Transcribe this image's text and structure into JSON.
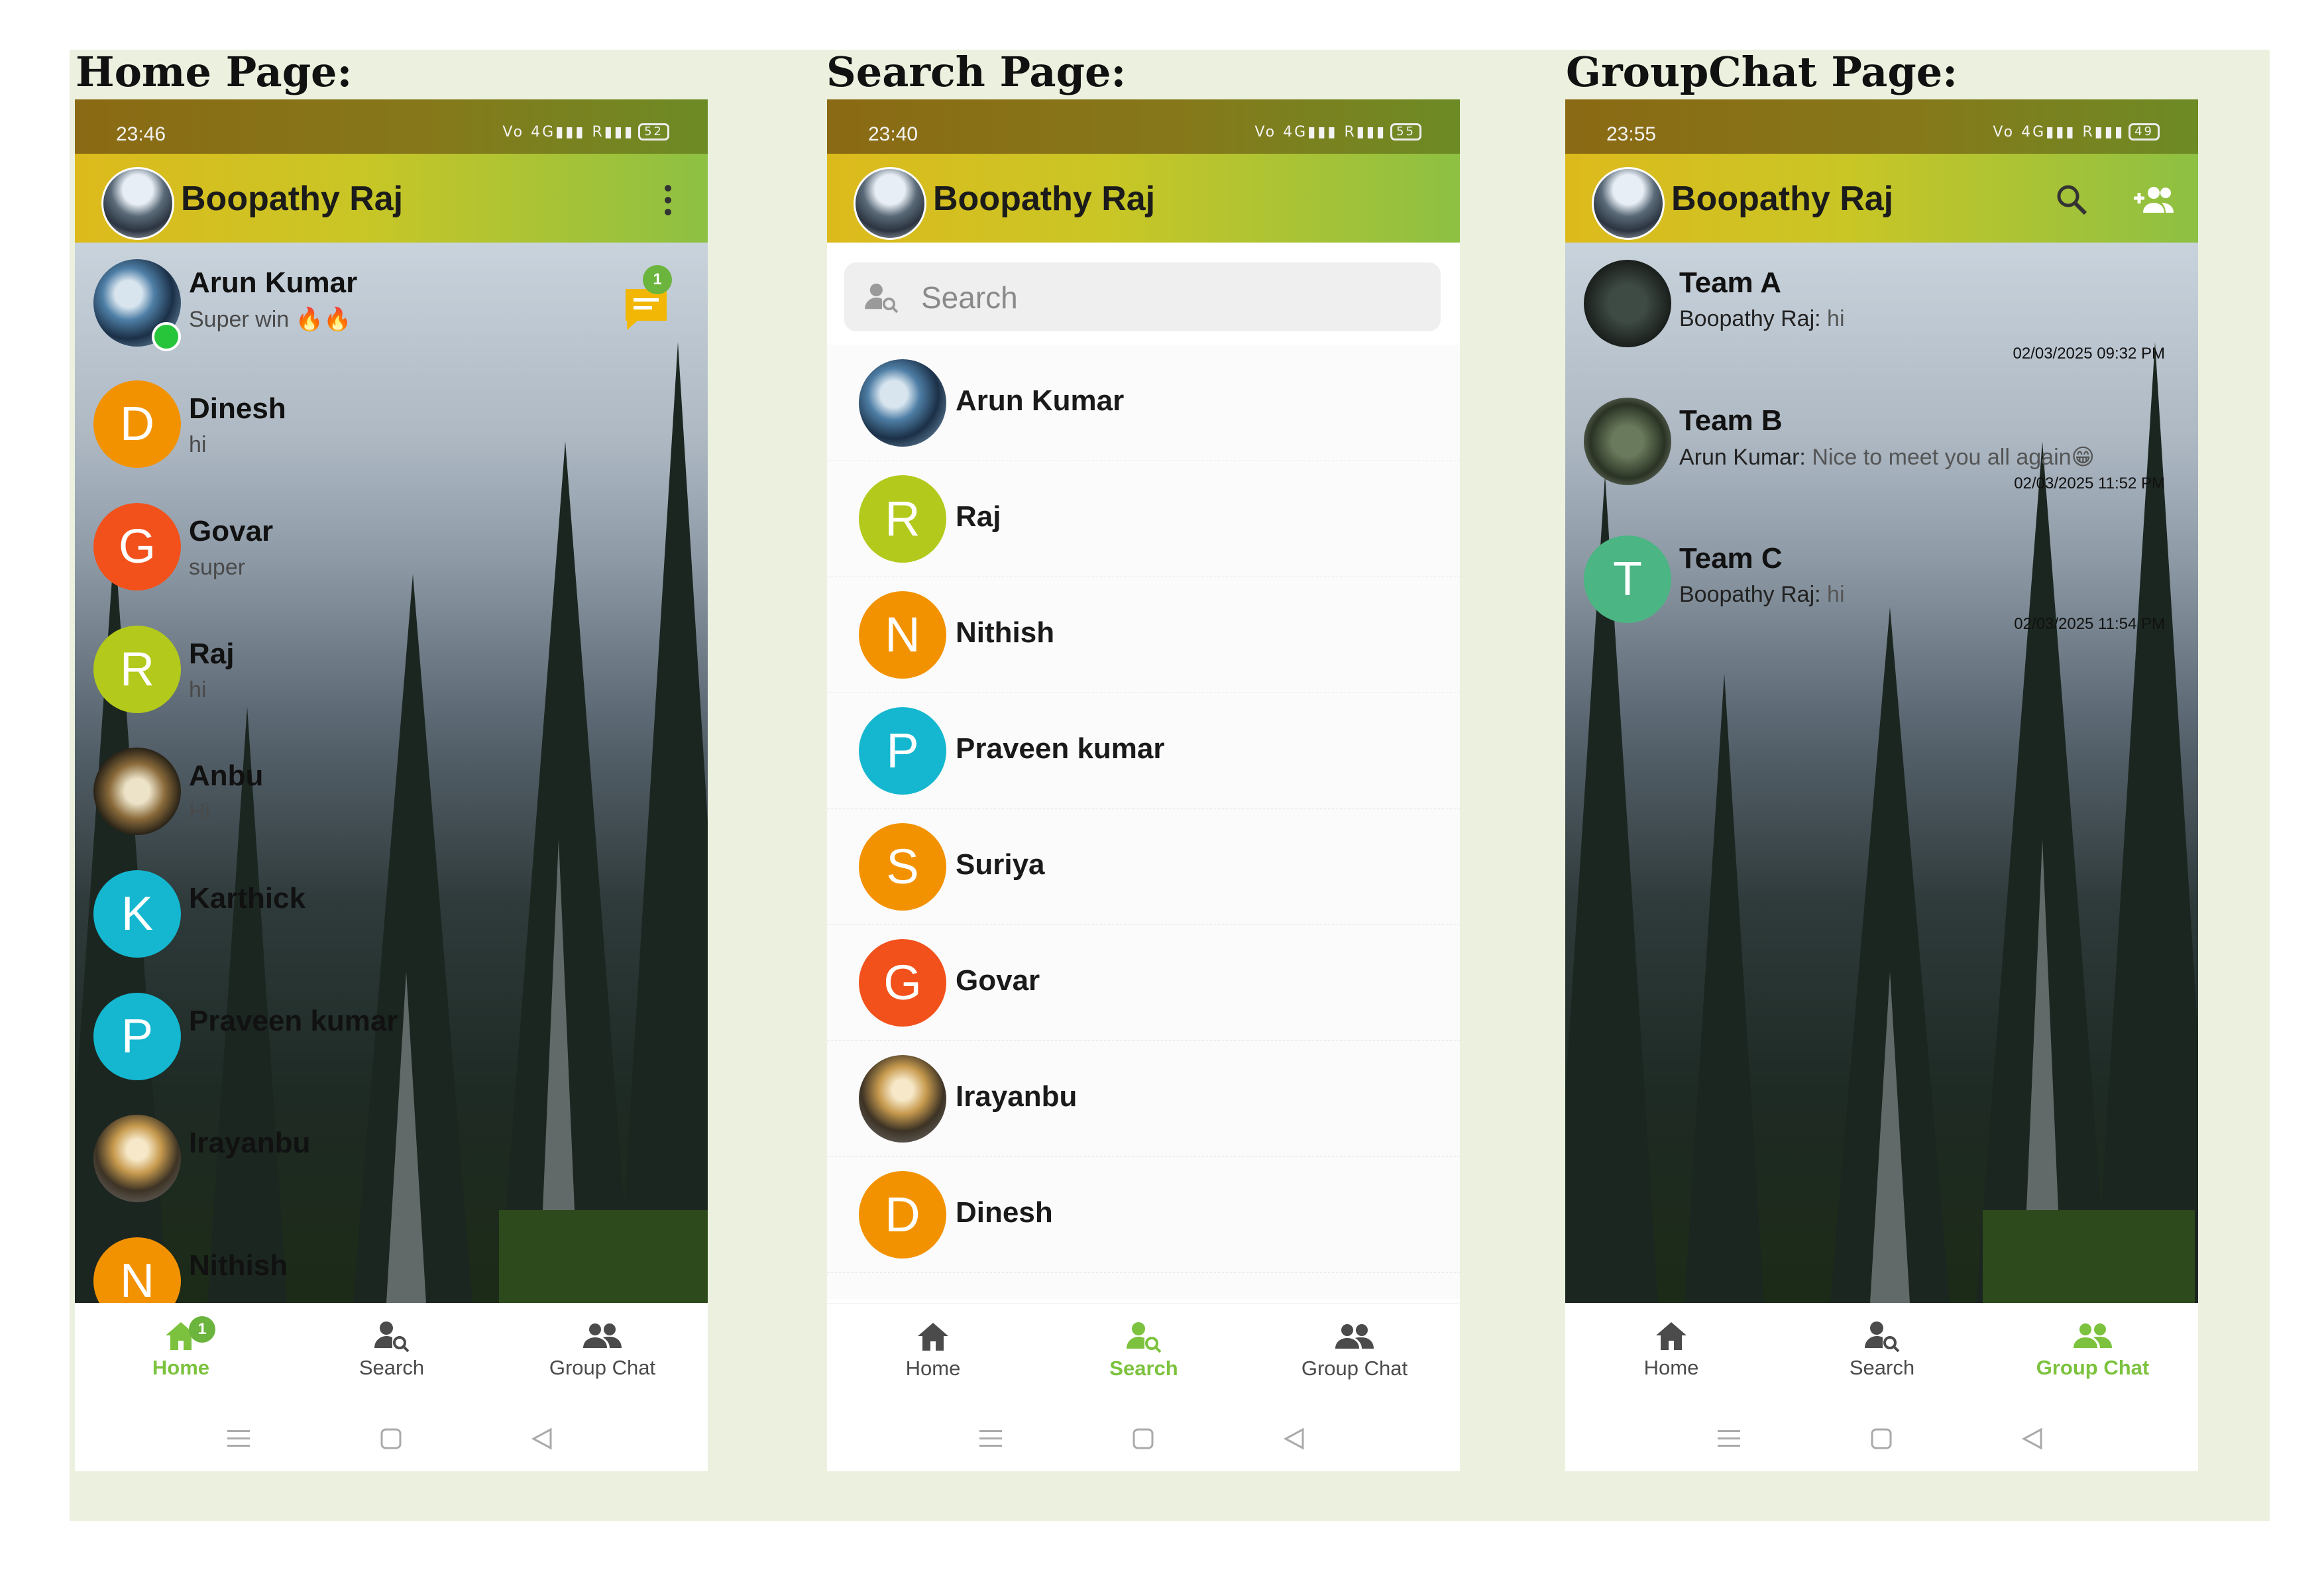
{
  "titles": {
    "home": "Home Page:",
    "search": "Search Page:",
    "group": "GroupChat Page:"
  },
  "user_name": "Boopathy Raj",
  "colors": {
    "accent_green": "#7cc23e",
    "orange": "#f39200",
    "red_orange": "#f2511b",
    "lime": "#b3c91b",
    "cyan": "#14b7cf",
    "teal": "#4bb583"
  },
  "home": {
    "status_time": "23:46",
    "battery": "52",
    "chats": [
      {
        "name": "Arun Kumar",
        "preview": "Super win 🔥🔥",
        "avatar": "photo",
        "online": true,
        "unread": "1"
      },
      {
        "name": "Dinesh",
        "preview": "hi",
        "letter": "D"
      },
      {
        "name": "Govar",
        "preview": "super",
        "letter": "G"
      },
      {
        "name": "Raj",
        "preview": "hi",
        "letter": "R"
      },
      {
        "name": "Anbu",
        "preview": "Hi",
        "avatar": "photo"
      },
      {
        "name": "Karthick",
        "preview": "",
        "letter": "K"
      },
      {
        "name": "Praveen kumar",
        "preview": "",
        "letter": "P"
      },
      {
        "name": "Irayanbu",
        "preview": "",
        "avatar": "photo"
      },
      {
        "name": "Nithish",
        "preview": "",
        "letter": "N"
      }
    ],
    "nav_badge": "1"
  },
  "search": {
    "status_time": "23:40",
    "battery": "55",
    "placeholder": "Search",
    "results": [
      {
        "name": "Arun Kumar",
        "avatar": "photo"
      },
      {
        "name": "Raj",
        "letter": "R"
      },
      {
        "name": "Nithish",
        "letter": "N"
      },
      {
        "name": "Praveen kumar",
        "letter": "P"
      },
      {
        "name": "Suriya",
        "letter": "S"
      },
      {
        "name": "Govar",
        "letter": "G"
      },
      {
        "name": "Irayanbu",
        "avatar": "photo"
      },
      {
        "name": "Dinesh",
        "letter": "D"
      }
    ]
  },
  "group": {
    "status_time": "23:55",
    "battery": "49",
    "groups": [
      {
        "name": "Team A",
        "sender": "Boopathy Raj:",
        "message": "hi",
        "time": "02/03/2025 09:32 PM",
        "avatar": "photo"
      },
      {
        "name": "Team B",
        "sender": "Arun Kumar:",
        "message": "Nice to meet you all again😁",
        "time": "02/03/2025 11:52 PM",
        "avatar": "photo"
      },
      {
        "name": "Team C",
        "sender": "Boopathy Raj:",
        "message": "hi",
        "time": "02/03/2025 11:54 PM",
        "letter": "T"
      }
    ]
  },
  "nav": {
    "home": "Home",
    "search": "Search",
    "group_chat": "Group Chat"
  },
  "icons": [
    "menu-kebab-icon",
    "search-icon",
    "add-group-icon",
    "home-icon",
    "person-search-icon",
    "group-icon",
    "chat-bubble-icon"
  ]
}
